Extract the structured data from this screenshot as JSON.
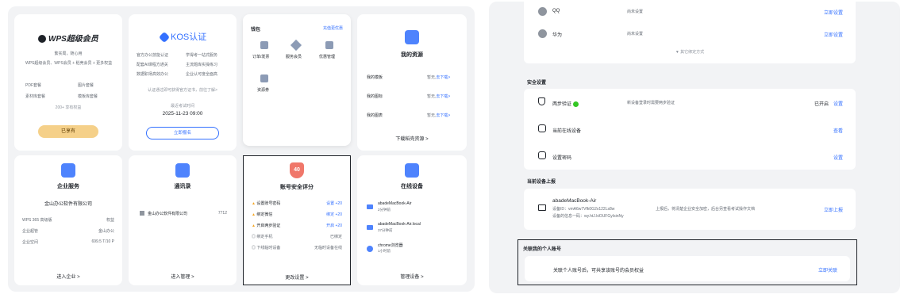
{
  "wps_card": {
    "brand": "WPS超级会员",
    "user": "繁实局，随心用",
    "benefit_line": "WPS超级会员、WPS会员 + 稻壳会员 + 更多权益",
    "features": [
      "PDF套餐",
      "图片套餐",
      "素材库套餐",
      "模板库套餐"
    ],
    "more": "200+ 享有权益",
    "button": "已享有"
  },
  "kos_card": {
    "brand": "KOS认证",
    "items": [
      "官方办公技能认证",
      "学得考一站式服务",
      "配套AI课程方通关",
      "主流题库实操练习",
      "数据职场高效办公",
      "企业认可度全面高"
    ],
    "note": "认证通过即可获得官方证书，前往了解>",
    "exam_label": "最近考试时间",
    "exam_date": "2025-11-23 09:00",
    "button": "立即报名"
  },
  "wallet_card": {
    "title": "钱包",
    "link": "充值更优惠",
    "items": [
      "订单/发票",
      "服务会员",
      "优惠管理",
      "资源券"
    ]
  },
  "resources_card": {
    "title": "我的资源",
    "rows": [
      {
        "label": "我的模板",
        "value": "暂无,",
        "link": "去下载>"
      },
      {
        "label": "我的图标",
        "value": "暂无,",
        "link": "去下载>"
      },
      {
        "label": "我的图表",
        "value": "暂无,",
        "link": "去下载>"
      }
    ],
    "footer": "下载稻壳资源 >"
  },
  "enterprise_card": {
    "title": "企业服务",
    "company": "金山办公软件有限公司",
    "rows": [
      {
        "label": "WPS 365 高级版",
        "value": "权益"
      },
      {
        "label": "企业超管",
        "value": "金山办公"
      },
      {
        "label": "企业空间",
        "value": "699.5 T/10 P"
      }
    ],
    "footer": "进入企业 >"
  },
  "contacts_card": {
    "title": "通讯录",
    "company": "金山办公软件有限公司",
    "count": "7712",
    "footer": "进入管理 >"
  },
  "security_score_card": {
    "score": "40",
    "title": "账号安全评分",
    "rows": [
      {
        "label": "设置账号密码",
        "value": "设置 +20",
        "warn": true
      },
      {
        "label": "绑定微信",
        "value": "绑定 +20",
        "warn": true
      },
      {
        "label": "开启两步验证",
        "value": "开启 +20",
        "warn": true
      },
      {
        "label": "绑定手机",
        "value": "已绑定",
        "warn": false
      },
      {
        "label": "下线临时设备",
        "value": "无临时设备在线",
        "warn": false
      }
    ],
    "footer": "更改设置 >"
  },
  "devices_card": {
    "title": "在线设备",
    "rows": [
      {
        "name": "abadeMacBook-Air",
        "time": "2分钟前"
      },
      {
        "name": "abadeMacBook-Air.local",
        "time": "37分钟前"
      },
      {
        "name": "chrome浏览器",
        "time": "1小时前"
      }
    ],
    "footer": "管理设备 >"
  },
  "right": {
    "login_rows": [
      {
        "label": "QQ",
        "desc": "尚未设置",
        "action": "立即设置"
      },
      {
        "label": "华为",
        "desc": "尚未设置",
        "action": "立即设置"
      }
    ],
    "collapse": "▼ 其它绑定方式",
    "security_title": "安全设置",
    "security_rows": [
      {
        "label": "两步验证",
        "desc": "新设备登录时需要两步验证",
        "status": "已开启",
        "action": "设置"
      },
      {
        "label": "当前在线设备",
        "desc": "",
        "status": "",
        "action": "查看"
      },
      {
        "label": "设置密码",
        "desc": "",
        "status": "",
        "action": "设置"
      }
    ],
    "device_title": "当前设备上报",
    "device_name": "abadeMacBook-Air",
    "device_id": "设备ID：vmA6w7Vfk0G2x122Ls8w",
    "device_fp": "设备的信息一码：wy.htJ.kiOUFGyIsinNy",
    "device_desc": "上报后，将清楚企业安全加密，后台另查看考试操作文档",
    "device_action": "立即上报",
    "personal_title": "关联我的个人账号",
    "personal_desc": "关联个人账号后，可共享该账号的会员权益",
    "personal_action": "立即关联"
  }
}
